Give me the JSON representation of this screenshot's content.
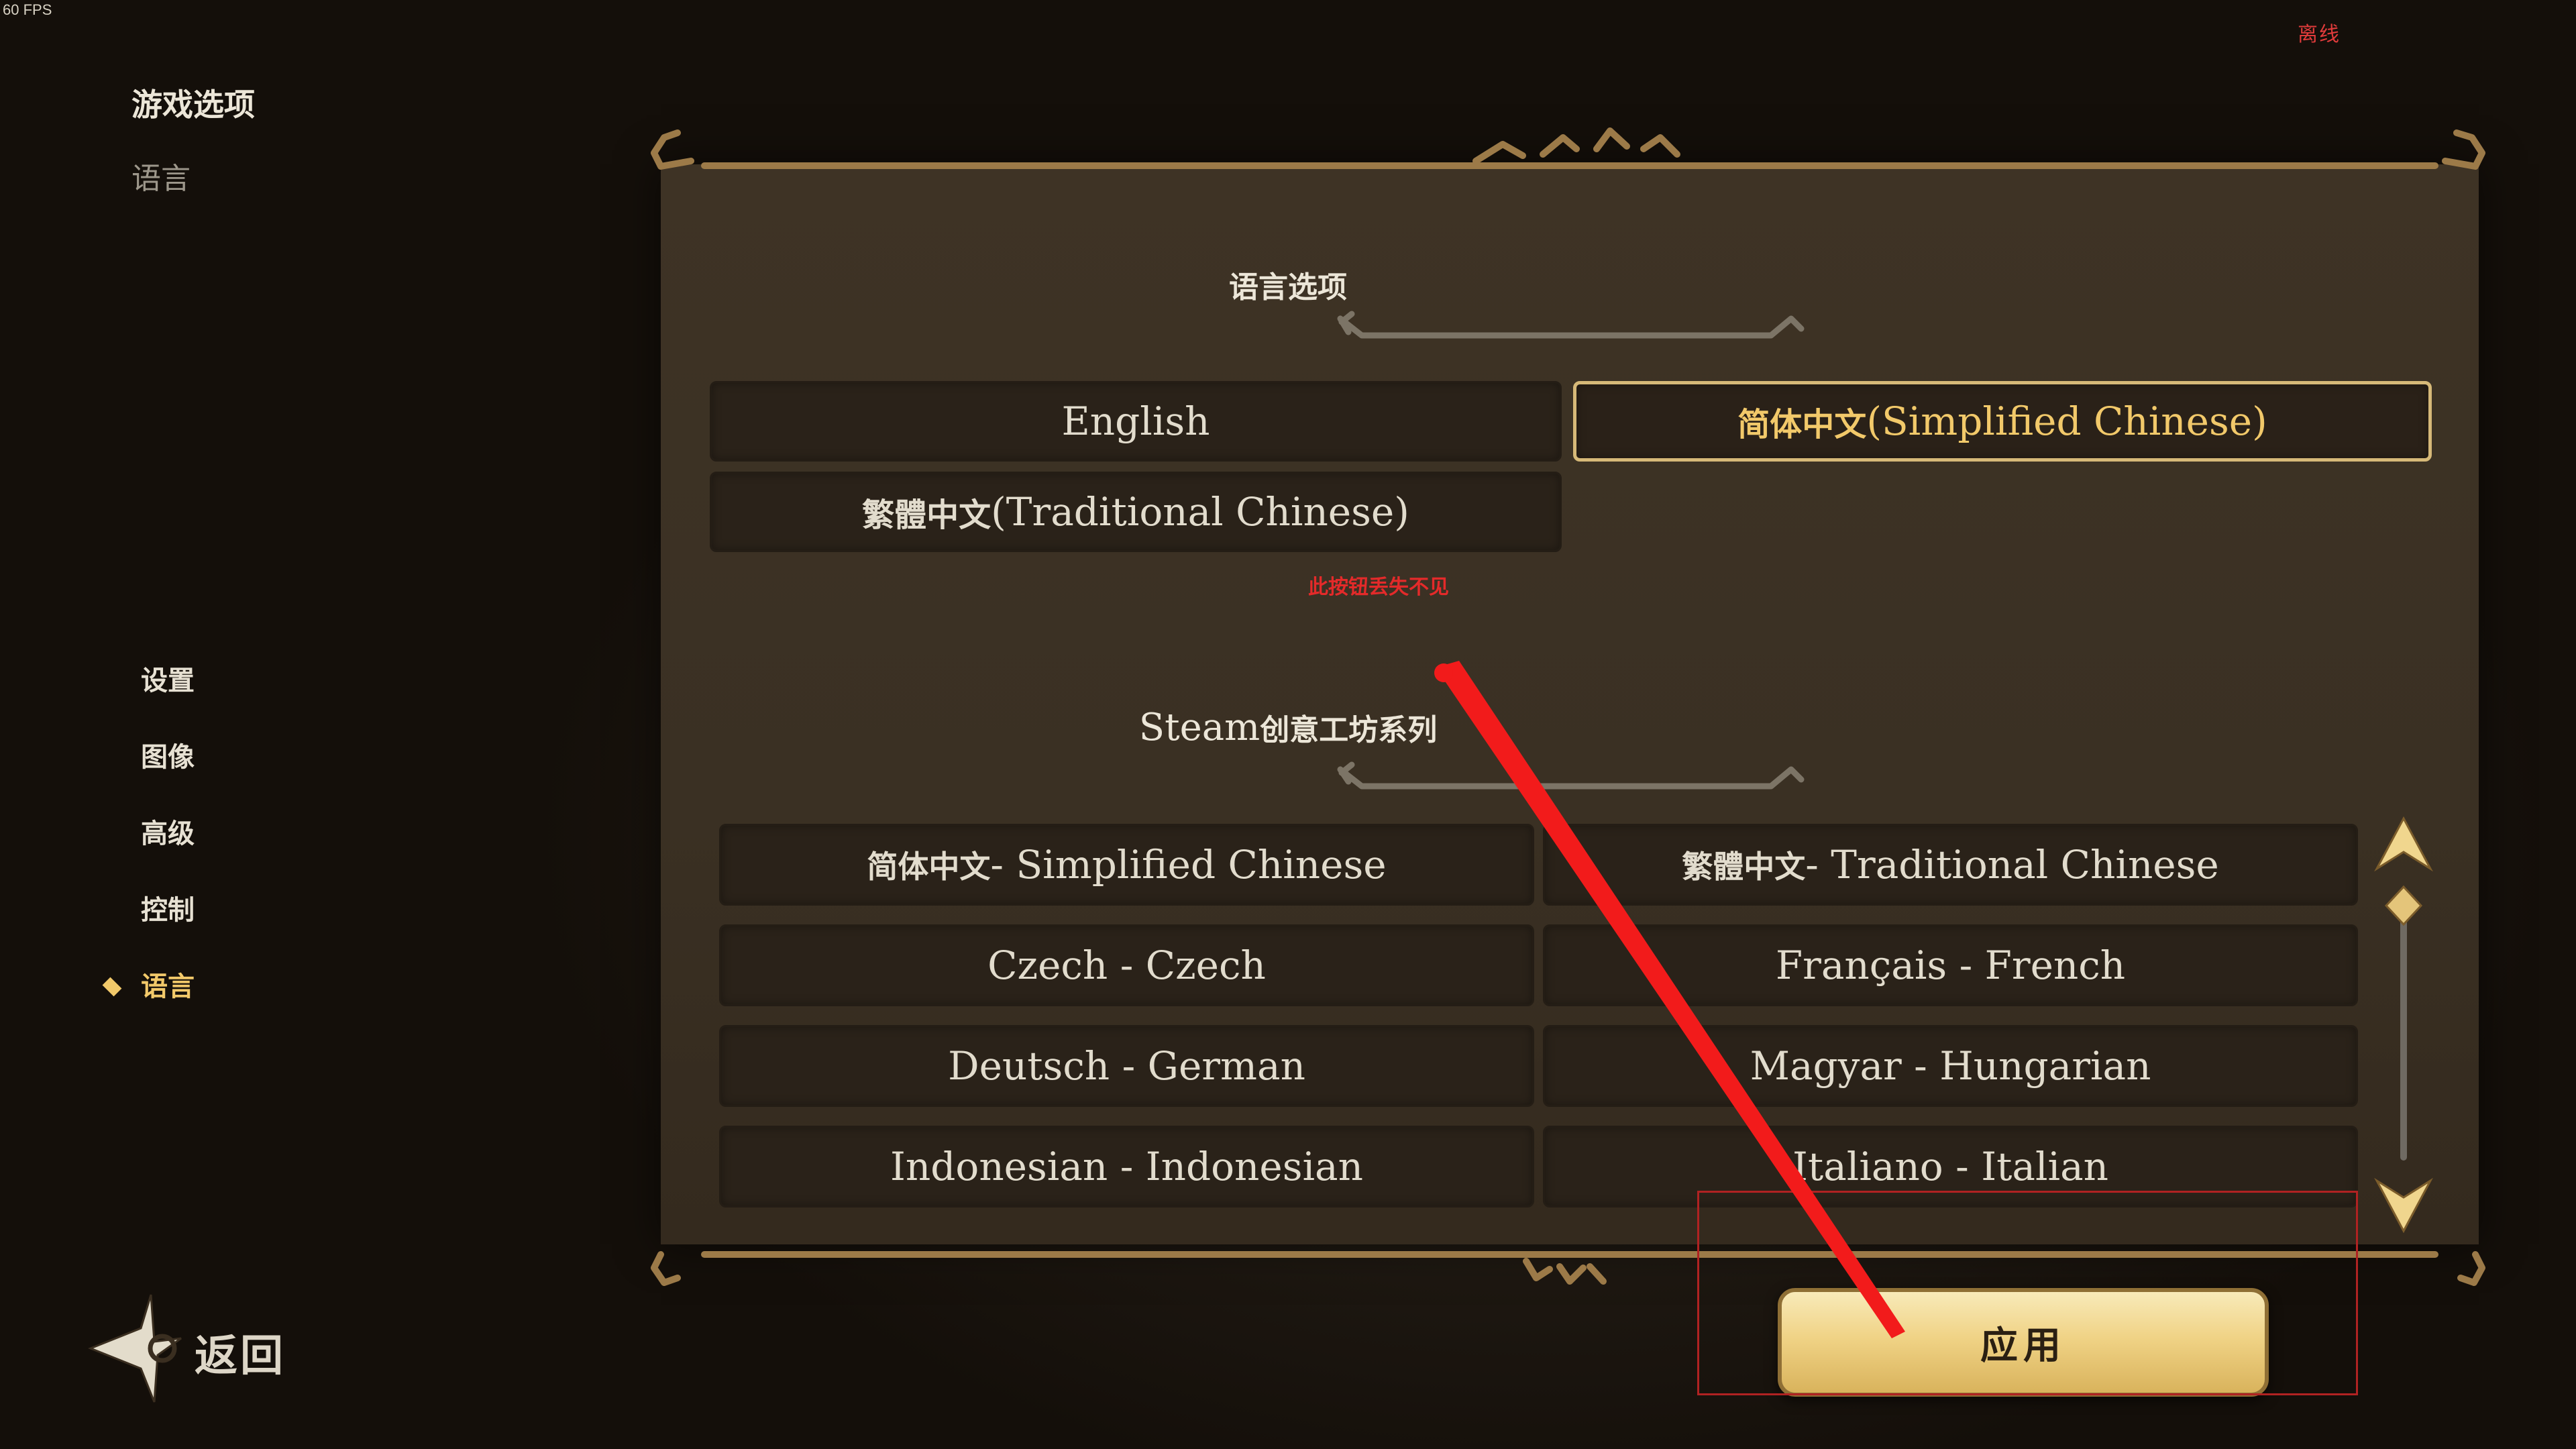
{
  "fps": "60 FPS",
  "status": {
    "offline": "离线"
  },
  "breadcrumb": {
    "title": "游戏选项",
    "subtitle": "语言"
  },
  "sidebar": {
    "items": [
      {
        "label": "设置",
        "active": false
      },
      {
        "label": "图像",
        "active": false
      },
      {
        "label": "高级",
        "active": false
      },
      {
        "label": "控制",
        "active": false
      },
      {
        "label": "语言",
        "active": true
      }
    ]
  },
  "back": {
    "label": "返回"
  },
  "language_section": {
    "title": "语言选项",
    "options": [
      {
        "label": "English",
        "selected": false
      },
      {
        "cjk": "简体中文",
        "label": " (Simplified Chinese)",
        "selected": true
      },
      {
        "cjk": "繁體中文",
        "label": " (Traditional Chinese)",
        "selected": false
      }
    ]
  },
  "workshop_section": {
    "title_prefix": "Steam",
    "title_cjk": "创意工坊系列",
    "items": [
      {
        "cjk": "简体中文",
        "label": " - Simplified Chinese"
      },
      {
        "cjk": "繁體中文",
        "label": " - Traditional Chinese"
      },
      {
        "label": "Czech - Czech"
      },
      {
        "label": "Français - French"
      },
      {
        "label": "Deutsch - German"
      },
      {
        "label": "Magyar - Hungarian"
      },
      {
        "label": "Indonesian - Indonesian"
      },
      {
        "label": "Italiano - Italian"
      }
    ]
  },
  "apply": {
    "label": "应用"
  },
  "annotation": {
    "text": "此按钮丢失不见"
  },
  "colors": {
    "accent": "#f2c96a",
    "panel": "#3b3024",
    "button": "#2a2219",
    "annotation": "#e42a2a"
  }
}
